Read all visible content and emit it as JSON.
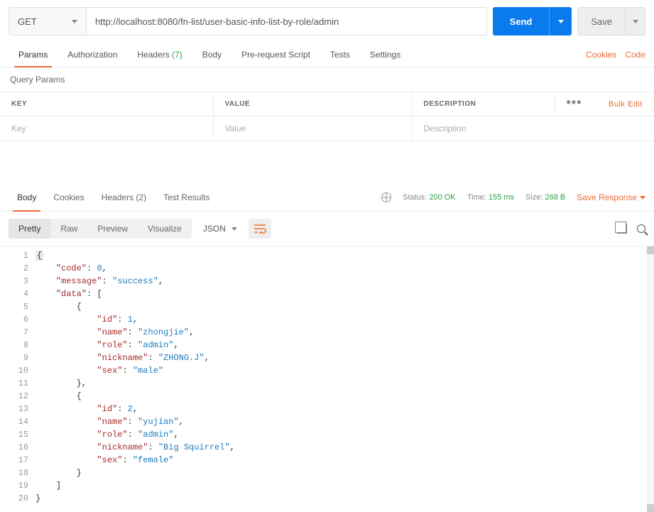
{
  "request": {
    "method": "GET",
    "url": "http://localhost:8080/fn-list/user-basic-info-list-by-role/admin",
    "send": "Send",
    "save": "Save"
  },
  "reqTabs": {
    "params": "Params",
    "authorization": "Authorization",
    "headers": "Headers",
    "headers_count": "(7)",
    "body": "Body",
    "prerequest": "Pre-request Script",
    "tests": "Tests",
    "settings": "Settings"
  },
  "rightLinks": {
    "cookies": "Cookies",
    "code": "Code"
  },
  "query": {
    "title": "Query Params",
    "cols": {
      "key": "KEY",
      "value": "VALUE",
      "description": "DESCRIPTION"
    },
    "placeholders": {
      "key": "Key",
      "value": "Value",
      "description": "Description"
    },
    "bulk": "Bulk Edit",
    "dots": "•••"
  },
  "respTabs": {
    "body": "Body",
    "cookies": "Cookies",
    "headers": "Headers",
    "headers_count": "(2)",
    "test_results": "Test Results"
  },
  "status": {
    "status_label": "Status:",
    "status_value": "200 OK",
    "time_label": "Time:",
    "time_value": "155 ms",
    "size_label": "Size:",
    "size_value": "268 B",
    "save_response": "Save Response"
  },
  "toolbar": {
    "pretty": "Pretty",
    "raw": "Raw",
    "preview": "Preview",
    "visualize": "Visualize",
    "format": "JSON"
  },
  "code": {
    "lines": [
      "{",
      "    \"code\": 0,",
      "    \"message\": \"success\",",
      "    \"data\": [",
      "        {",
      "            \"id\": 1,",
      "            \"name\": \"zhongjie\",",
      "            \"role\": \"admin\",",
      "            \"nickname\": \"ZHONG.J\",",
      "            \"sex\": \"male\"",
      "        },",
      "        {",
      "            \"id\": 2,",
      "            \"name\": \"yujian\",",
      "            \"role\": \"admin\",",
      "            \"nickname\": \"Big Squirrel\",",
      "            \"sex\": \"female\"",
      "        }",
      "    ]",
      "}"
    ]
  }
}
